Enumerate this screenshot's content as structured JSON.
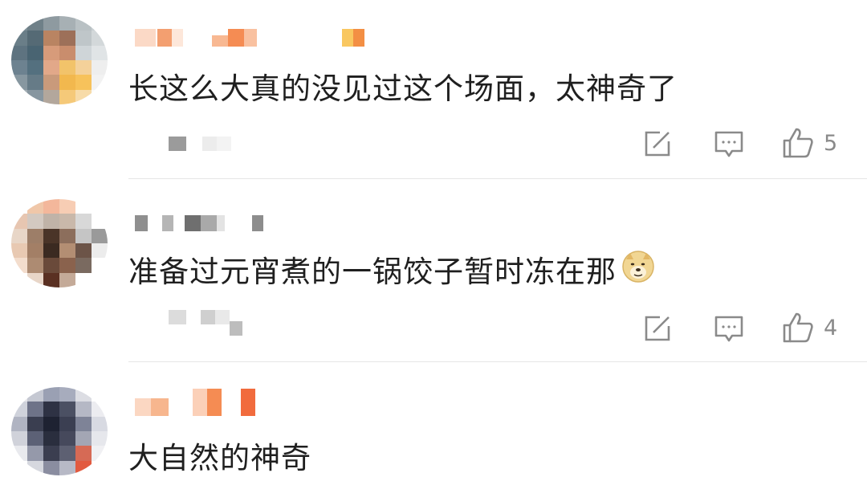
{
  "comments": [
    {
      "text": "长这么大真的没见过这个场面，太神奇了",
      "like_count": "5",
      "has_emoji": false
    },
    {
      "text": "准备过元宵煮的一锅饺子暂时冻在那",
      "like_count": "4",
      "has_emoji": true,
      "emoji": "doge-emoji"
    },
    {
      "text": "大自然的神奇",
      "like_count": "",
      "has_emoji": false
    }
  ],
  "icons": {
    "repost": "repost-icon",
    "reply": "comment-icon",
    "like": "thumbs-up-icon"
  },
  "colors": {
    "text": "#1f1f1f",
    "icon": "#8a8a8a",
    "divider": "#e6e6e6"
  }
}
